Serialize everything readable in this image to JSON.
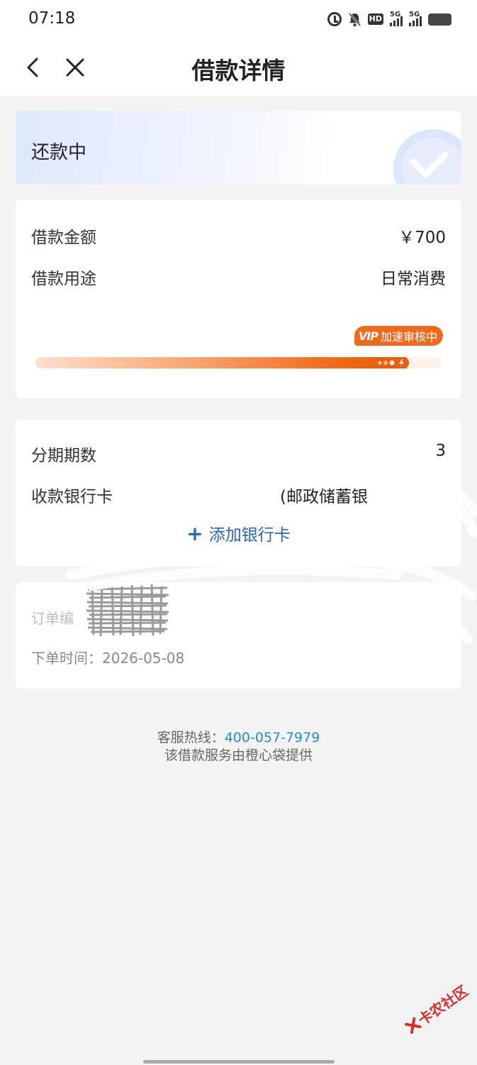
{
  "status_bar": {
    "time": "07:18",
    "icons": [
      "alarm-icon",
      "bell-off-icon",
      "hd-icon",
      "signal-5g-icon",
      "signal-5g-icon",
      "battery-icon"
    ],
    "hd_label": "HD",
    "network_label_1": "5G",
    "network_label_2": "5G"
  },
  "nav": {
    "title": "借款详情",
    "back_icon": "chevron-left-icon",
    "close_icon": "close-icon"
  },
  "status_card": {
    "status": "还款中",
    "icon": "check-icon"
  },
  "loan_info": {
    "amount_label": "借款金额",
    "amount_value": "￥700",
    "purpose_label": "借款用途",
    "purpose_value": "日常消费",
    "vip_logo": "VIP",
    "vip_text": "加速审核中",
    "progress": 0.92
  },
  "bank_info": {
    "installments_label": "分期期数",
    "installments_value": "3",
    "bank_card_label": "收款银行卡",
    "bank_card_value": "(邮政储蓄银",
    "add_card_label": "添加银行卡"
  },
  "order_info": {
    "order_no_label": "订单编",
    "order_time": "下单时间：2026-05-08"
  },
  "footer": {
    "hotline_label": "客服热线：",
    "hotline_number": "400-057-7979",
    "provider": "该借款服务由橙心袋提供"
  },
  "watermark": {
    "text": "卡农社区"
  },
  "colors": {
    "accent_orange": "#ee6a1f",
    "link_blue": "#2a63c4",
    "hotline_blue": "#1f8fd6",
    "background": "#f3f3f3"
  }
}
